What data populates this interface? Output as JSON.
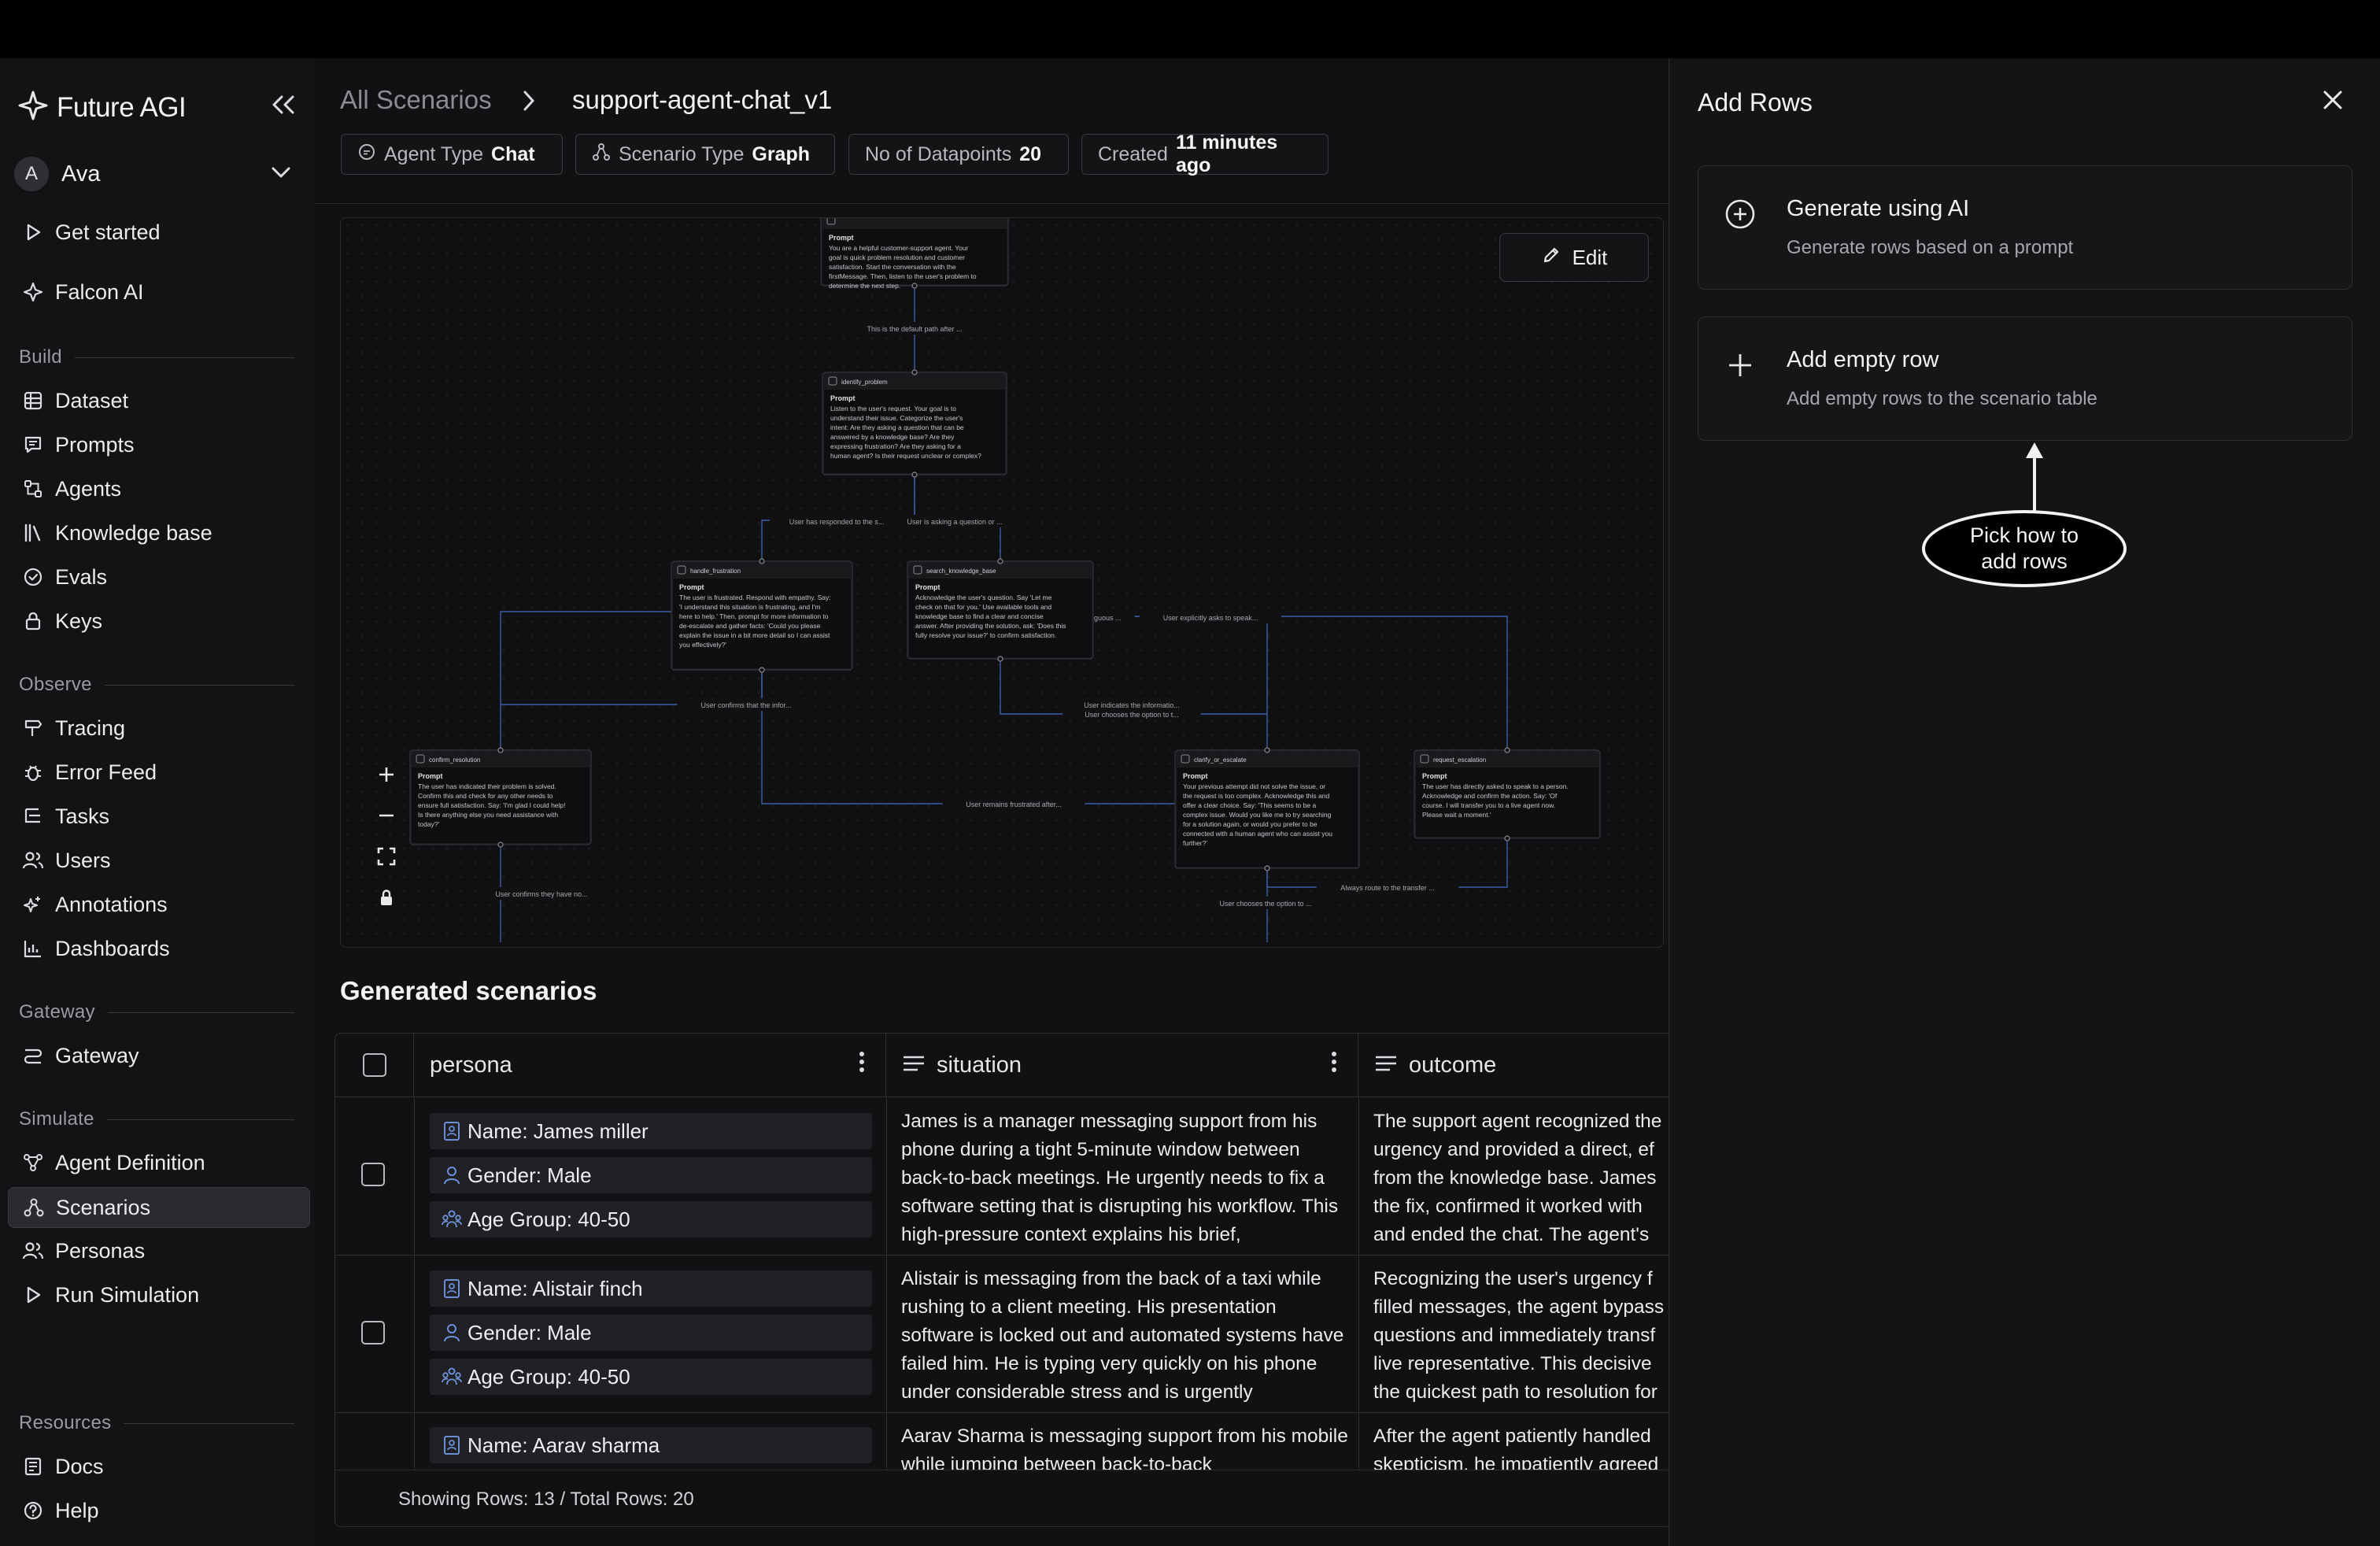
{
  "brand": {
    "name": "Future AGI"
  },
  "user": {
    "initial": "A",
    "name": "Ava"
  },
  "sidebar": {
    "top_items": [
      {
        "label": "Get started",
        "icon": "play-icon"
      },
      {
        "label": "Falcon AI",
        "icon": "sparkle-icon"
      }
    ],
    "sections": [
      {
        "title": "Build",
        "items": [
          "Dataset",
          "Prompts",
          "Agents",
          "Knowledge base",
          "Evals",
          "Keys"
        ]
      },
      {
        "title": "Observe",
        "items": [
          "Tracing",
          "Error Feed",
          "Tasks",
          "Users",
          "Annotations",
          "Dashboards"
        ]
      },
      {
        "title": "Gateway",
        "items": [
          "Gateway"
        ]
      },
      {
        "title": "Simulate",
        "items": [
          "Agent Definition",
          "Scenarios",
          "Personas",
          "Run Simulation"
        ]
      },
      {
        "title": "Resources",
        "items": [
          "Docs",
          "Help"
        ]
      }
    ],
    "active_item": "Scenarios"
  },
  "breadcrumb": {
    "parent": "All Scenarios",
    "current": "support-agent-chat_v1"
  },
  "chips": [
    {
      "key": "Agent Type",
      "value": "Chat"
    },
    {
      "key": "Scenario Type",
      "value": "Graph"
    },
    {
      "key": "No of Datapoints",
      "value": "20"
    },
    {
      "key": "Created",
      "value": "11 minutes ago"
    }
  ],
  "canvas": {
    "edit_label": "Edit",
    "nodes": [
      {
        "name": "",
        "prompt_label": "Prompt",
        "text": [
          "You are a helpful customer-support agent. Your",
          "goal is quick problem resolution and customer",
          "satisfaction. Start the conversation with the",
          "firstMessage. Then, listen to the user's problem to",
          "determine the next step."
        ]
      },
      {
        "name": "identify_problem",
        "prompt_label": "Prompt",
        "text": [
          "Listen to the user's request. Your goal is to",
          "understand their issue. Categorize the user's",
          "intent: Are they asking a question that can be",
          "answered by a knowledge base? Are they",
          "expressing frustration? Are they asking for a",
          "human agent? Is their request unclear or complex?"
        ]
      },
      {
        "name": "handle_frustration",
        "prompt_label": "Prompt",
        "text": [
          "The user is frustrated. Respond with empathy. Say:",
          "'I understand this situation is frustrating, and I'm",
          "here to help.' Then, prompt for more information to",
          "de-escalate and gather facts: 'Could you please",
          "explain the issue in a bit more detail so I can assist",
          "you effectively?'"
        ]
      },
      {
        "name": "search_knowledge_base",
        "prompt_label": "Prompt",
        "text": [
          "Acknowledge the user's question. Say 'Let me",
          "check on that for you.' Use available tools and",
          "knowledge base to find a clear and concise",
          "answer. After providing the solution, ask: 'Does this",
          "fully resolve your issue?' to confirm satisfaction."
        ]
      },
      {
        "name": "confirm_resolution",
        "prompt_label": "Prompt",
        "text": [
          "The user has indicated their problem is solved.",
          "Confirm this and check for any other needs to",
          "ensure full satisfaction. Say: 'I'm glad I could help!",
          "Is there anything else you need assistance with",
          "today?'"
        ]
      },
      {
        "name": "clarify_or_escalate",
        "prompt_label": "Prompt",
        "text": [
          "Your previous attempt did not solve the issue, or",
          "the request is too complex. Acknowledge this and",
          "offer a clear choice. Say: 'This seems to be a",
          "complex issue. Would you like me to try searching",
          "for a solution again, or would you prefer to be",
          "connected with a human agent who can assist you",
          "further?'"
        ]
      },
      {
        "name": "request_escalation",
        "prompt_label": "Prompt",
        "text": [
          "The user has directly asked to speak to a person.",
          "Acknowledge and confirm the action. Say: 'Of",
          "course. I will transfer you to a live agent now.",
          "Please wait a moment.'"
        ]
      }
    ],
    "edge_labels": [
      "This is the default path after ...",
      "User has responded to the s...",
      "User is asking a question or ...",
      "is ambiguous ...",
      "User explicitly asks to speak...",
      "User confirms that the infor...",
      "User indicates the informatio...",
      "User chooses the option to t...",
      "User remains frustrated after...",
      "User confirms they have no...",
      "Always route to the transfer ...",
      "User chooses the option to ..."
    ]
  },
  "generated": {
    "title": "Generated scenarios",
    "columns": [
      "persona",
      "situation",
      "outcome"
    ],
    "rows": [
      {
        "persona": [
          "Name: James miller",
          "Gender: Male",
          "Age Group: 40-50"
        ],
        "situation": "James is a manager messaging support from his phone during a tight 5-minute window between back-to-back meetings. He urgently needs to fix a software setting that is disrupting his workflow. This high-pressure context explains his brief,",
        "outcome": "The support agent recognized the urgency and provided a direct, ef from the knowledge base. James the fix, confirmed it worked with and ended the chat. The agent's"
      },
      {
        "persona": [
          "Name: Alistair finch",
          "Gender: Male",
          "Age Group: 40-50"
        ],
        "situation": "Alistair is messaging from the back of a taxi while rushing to a client meeting. His presentation software is locked out and automated systems have failed him. He is typing very quickly on his phone under considerable stress and is urgently",
        "outcome": "Recognizing the user's urgency f filled messages, the agent bypass questions and immediately transf live representative. This decisive the quickest path to resolution for"
      },
      {
        "persona": [
          "Name: Aarav sharma"
        ],
        "situation": "Aarav Sharma is messaging support from his mobile while jumping between back-to-back",
        "outcome": "After the agent patiently handled skepticism, he impatiently agreed"
      }
    ],
    "footer": "Showing Rows: 13 / Total Rows: 20"
  },
  "panel": {
    "title": "Add Rows",
    "options": [
      {
        "title": "Generate using AI",
        "desc": "Generate rows based on a prompt",
        "icon": "plus-circle-icon"
      },
      {
        "title": "Add empty row",
        "desc": "Add empty rows to the scenario table",
        "icon": "plus-icon"
      }
    ],
    "callout": [
      "Pick how to",
      "add rows"
    ]
  },
  "colors": {
    "background": "#111113",
    "sidebar": "#131315",
    "accent_edge": "#3c5ea8",
    "persona_icon": "#6b8fd6"
  }
}
